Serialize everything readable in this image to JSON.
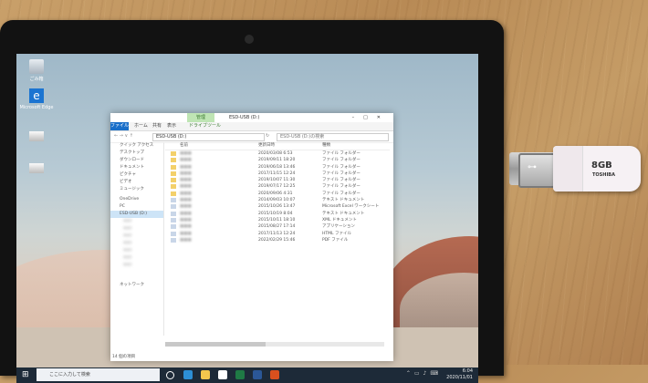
{
  "desktop": {
    "icons": [
      {
        "label": "ごみ箱",
        "icon": "recycle-bin-icon"
      },
      {
        "label": "Microsoft Edge",
        "icon": "edge-icon"
      },
      {
        "label": "",
        "icon": "drive-icon"
      },
      {
        "label": "",
        "icon": "drive-icon"
      }
    ]
  },
  "explorer": {
    "context_tab": "管理",
    "title": "ESD-USB (D:)",
    "ribbon_tabs": [
      "ファイル",
      "ホーム",
      "共有",
      "表示",
      "ドライブツール"
    ],
    "address": "ESD-USB (D:)",
    "search_placeholder": "ESD-USB (D:)の検索",
    "columns": [
      "名前",
      "更新日時",
      "種類"
    ],
    "nav_items": [
      "クイック アクセス",
      "デスクトップ",
      "ダウンロード",
      "ドキュメント",
      "ピクチャ",
      "ビデオ",
      "ミュージック",
      "OneDrive",
      "PC",
      "ESD-USB (D:)",
      "ネットワーク"
    ],
    "rows": [
      {
        "name": "■■■",
        "date": "2020/03/08 6:53",
        "type": "ファイル フォルダー"
      },
      {
        "name": "■■■",
        "date": "2019/09/11 18:20",
        "type": "ファイル フォルダー"
      },
      {
        "name": "■■■",
        "date": "2019/06/18 13:46",
        "type": "ファイル フォルダー"
      },
      {
        "name": "■■■",
        "date": "2017/11/15 12:24",
        "type": "ファイル フォルダー"
      },
      {
        "name": "■■■",
        "date": "2019/10/07 11:30",
        "type": "ファイル フォルダー"
      },
      {
        "name": "■■■",
        "date": "2019/07/17 12:25",
        "type": "ファイル フォルダー"
      },
      {
        "name": "■■■",
        "date": "2020/09/06 4:31",
        "type": "ファイル フォルダー"
      },
      {
        "name": "■■■",
        "date": "2014/09/03 10:07",
        "type": "テキスト ドキュメント"
      },
      {
        "name": "■■■",
        "date": "2015/10/26 13:47",
        "type": "Microsoft Excel ワークシート"
      },
      {
        "name": "■■■",
        "date": "2015/10/19 8:04",
        "type": "テキスト ドキュメント"
      },
      {
        "name": "■■■",
        "date": "2015/10/11 18:10",
        "type": "XML ドキュメント"
      },
      {
        "name": "■■■",
        "date": "2015/08/27 17:14",
        "type": "アプリケーション"
      },
      {
        "name": "■■■",
        "date": "2017/11/13 12:24",
        "type": "HTML ファイル"
      },
      {
        "name": "■■■",
        "date": "2022/02/29 15:46",
        "type": "PDF ファイル"
      }
    ],
    "status": "14 個の項目"
  },
  "taskbar": {
    "search_placeholder": "ここに入力して検索",
    "time": "6:04",
    "date": "2020/11/01",
    "pinned": [
      {
        "icon": "task-view-icon",
        "color": "#ffffff"
      },
      {
        "icon": "edge-icon",
        "color": "#2d8fd5"
      },
      {
        "icon": "file-explorer-icon",
        "color": "#f3c64d"
      },
      {
        "icon": "store-icon",
        "color": "#ffffff"
      },
      {
        "icon": "excel-icon",
        "color": "#1f7a45"
      },
      {
        "icon": "word-icon",
        "color": "#2b5797"
      },
      {
        "icon": "app-icon",
        "color": "#d9501e"
      }
    ]
  },
  "usb_drive": {
    "capacity": "8GB",
    "brand": "TOSHIBA"
  }
}
